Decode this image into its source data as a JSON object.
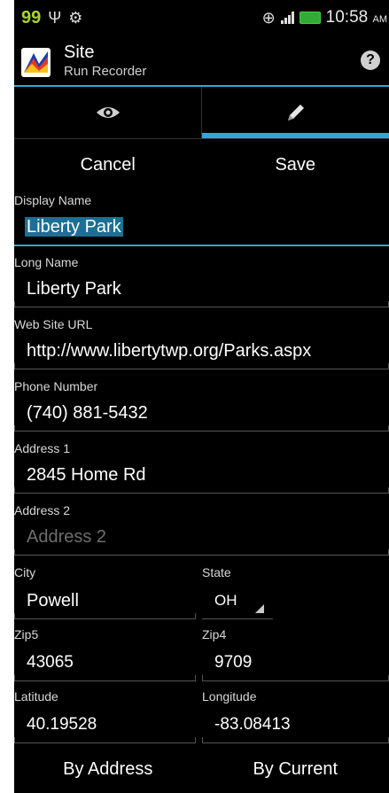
{
  "status_bar": {
    "badge": "99",
    "time": "10:58",
    "ampm": "AM"
  },
  "action_bar": {
    "title": "Site",
    "subtitle": "Run Recorder",
    "help_icon": "?"
  },
  "tabs": [
    {
      "icon": "eye-icon"
    },
    {
      "icon": "pencil-icon",
      "selected": true
    }
  ],
  "buttons": {
    "cancel": "Cancel",
    "save": "Save",
    "by_address": "By Address",
    "by_current": "By Current"
  },
  "form": {
    "display_name": {
      "label": "Display Name",
      "value": "Liberty Park"
    },
    "long_name": {
      "label": "Long Name",
      "value": "Liberty Park"
    },
    "web_site": {
      "label": "Web Site URL",
      "value": "http://www.libertytwp.org/Parks.aspx"
    },
    "phone": {
      "label": "Phone Number",
      "value": "(740) 881-5432"
    },
    "address1": {
      "label": "Address 1",
      "value": "2845 Home Rd"
    },
    "address2": {
      "label": "Address 2",
      "placeholder": "Address 2"
    },
    "city": {
      "label": "City",
      "value": "Powell"
    },
    "state": {
      "label": "State",
      "value": "OH"
    },
    "zip5": {
      "label": "Zip5",
      "value": "43065"
    },
    "zip4": {
      "label": "Zip4",
      "value": "9709"
    },
    "latitude": {
      "label": "Latitude",
      "value": "40.19528"
    },
    "longitude": {
      "label": "Longitude",
      "value": "-83.08413"
    }
  },
  "colors": {
    "accent": "#2aa9e0",
    "background": "#000000",
    "text_selection": "#1d6f93"
  }
}
